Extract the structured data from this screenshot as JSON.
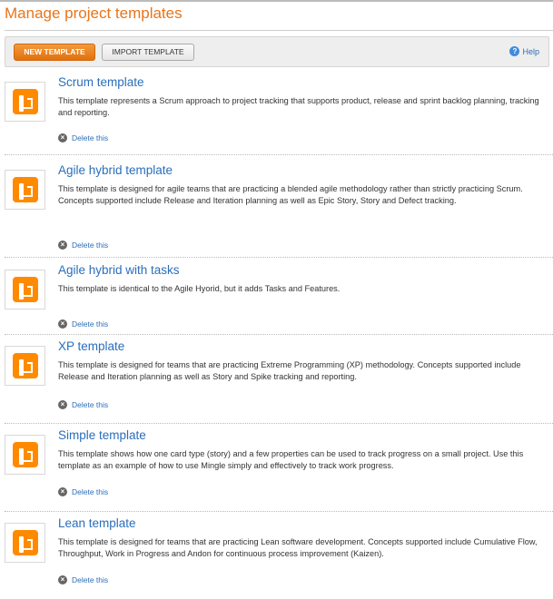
{
  "page_title": "Manage project templates",
  "toolbar": {
    "new_label": "NEW TEMPLATE",
    "import_label": "IMPORT TEMPLATE",
    "help_label": "Help"
  },
  "delete_label": "Delete this",
  "templates": [
    {
      "title": "Scrum template",
      "description": "This template represents a Scrum approach to project tracking that supports product, release and sprint backlog planning, tracking and reporting."
    },
    {
      "title": "Agile hybrid template",
      "description": "This template is designed for agile teams that are practicing a blended agile methodology rather than strictly practicing Scrum. Concepts supported include Release and Iteration planning as well as Epic Story, Story and Defect tracking."
    },
    {
      "title": "Agile hybrid with tasks",
      "description": "This template is identical to the Agile Hyorid, but it adds Tasks and Features."
    },
    {
      "title": "XP template",
      "description": "This template is designed for teams that are practicing Extreme Programming (XP) methodology. Concepts supported include Release and Iteration planning as well as Story and Spike tracking and reporting."
    },
    {
      "title": "Simple template",
      "description": "This template shows how one card type (story) and a few properties can be used to track progress on a small project. Use this template as an example of how to use Mingle simply and effectively to track work progress."
    },
    {
      "title": "Lean template",
      "description": "This template is designed for teams that are practicing Lean software development. Concepts supported include Cumulative Flow, Throughput, Work in Progress and Andon for continuous process improvement (Kaizen)."
    }
  ],
  "colors": {
    "accent": "#e8741a",
    "link": "#2a6ebb"
  }
}
